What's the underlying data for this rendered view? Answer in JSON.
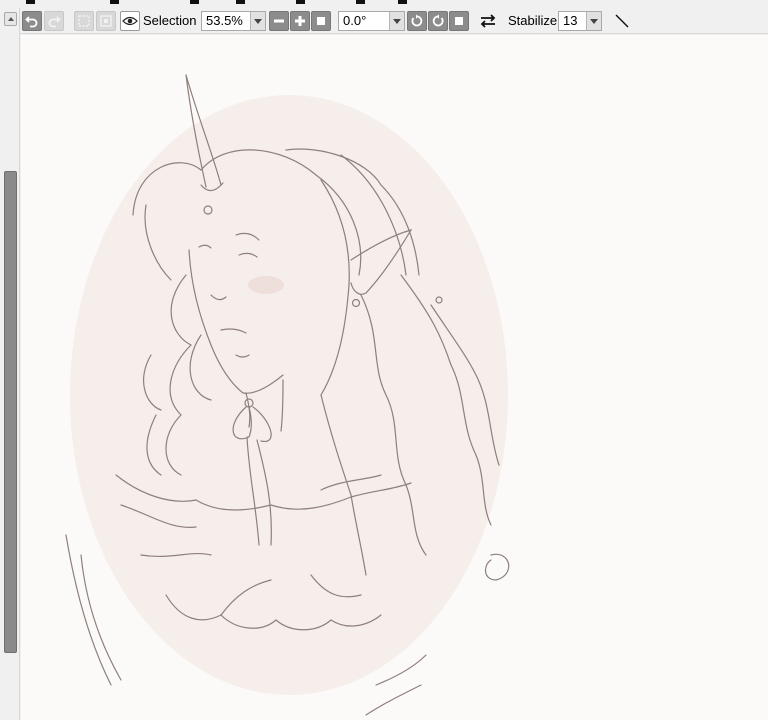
{
  "toolbar": {
    "selection_label": "Selection",
    "zoom_value": "53.5%",
    "rotation_value": "0.0°",
    "stabilizer_label": "Stabilizer",
    "stabilizer_value": "13"
  },
  "icons": {
    "undo": "undo-icon",
    "redo": "redo-icon",
    "deselect": "deselect-icon",
    "invert": "invert-selection-icon",
    "eye": "eye-icon",
    "zoom_out": "minus-icon",
    "zoom_in": "plus-icon",
    "zoom_reset": "square-icon",
    "rotate_ccw": "rotate-ccw-icon",
    "rotate_cw": "rotate-cw-icon",
    "rotate_reset": "square-icon",
    "flip": "flip-horizontal-icon",
    "stroke": "straight-line-icon"
  },
  "colors": {
    "canvas_bg": "#fcfaf8",
    "oval_fill": "#f5eeeb",
    "sketch_stroke": "#8f7f7b",
    "button_gray": "#8c8c8c"
  }
}
